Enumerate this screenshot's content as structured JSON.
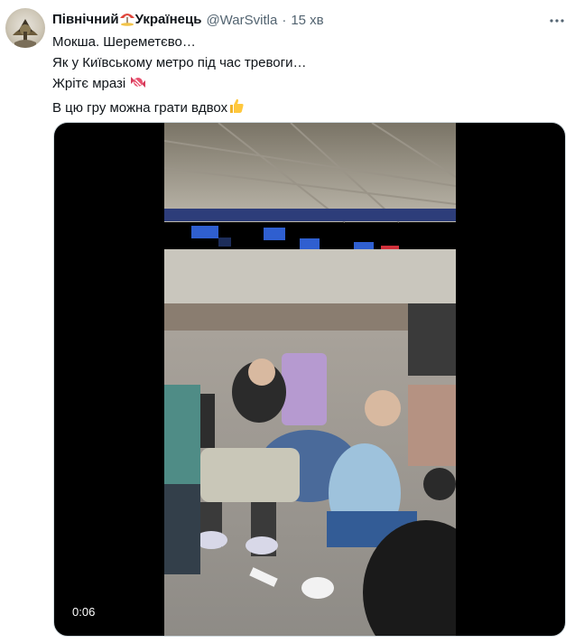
{
  "tweet": {
    "display_name": "Північний",
    "display_name_suffix": "Українець",
    "handle": "@WarSvitla",
    "separator": "·",
    "time": "15 хв",
    "text_lines": [
      "Мокша. Шереметєво…",
      "Як у Київському метро під час тревоги…",
      "Жрітє мразі",
      "В цю гру можна грати вдвох"
    ]
  },
  "media": {
    "type": "video",
    "elapsed": "0:06"
  },
  "icons": {
    "name_emoji": "umbrella-on-ground-icon",
    "line3_emoji": "candy-icon",
    "line4_emoji": "thumbs-up-icon",
    "more": "more-icon"
  },
  "colors": {
    "text": "#0f1419",
    "secondary": "#536471",
    "media_bg": "#000000"
  }
}
